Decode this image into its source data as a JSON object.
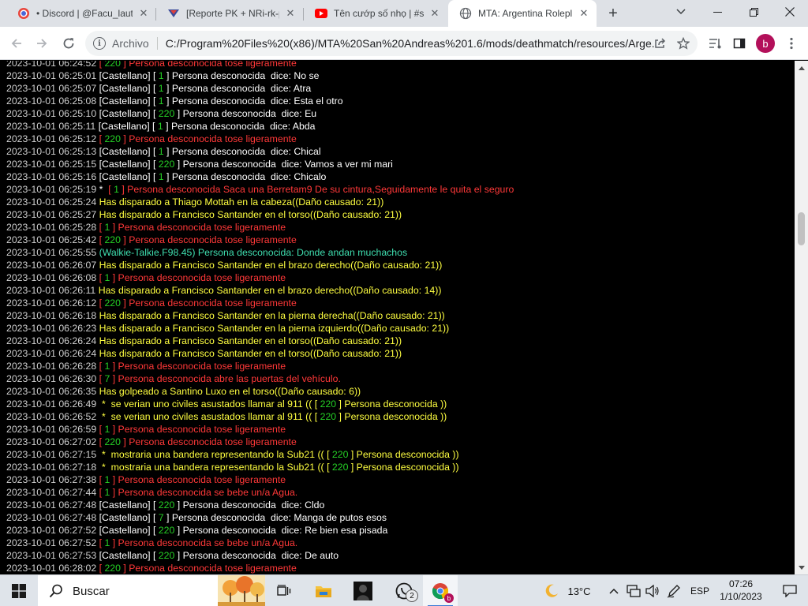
{
  "browser": {
    "tabs": [
      {
        "title": "• Discord | @Facu_laut",
        "active": false,
        "favicon": "discord-favicon"
      },
      {
        "title": "[Reporte PK + NRi-rk-p",
        "active": false,
        "favicon": "forum-favicon"
      },
      {
        "title": "Tên cướp số nhọ | #sho",
        "active": false,
        "favicon": "youtube-favicon"
      },
      {
        "title": "MTA: Argentina Rolepl",
        "active": true,
        "favicon": "globe-favicon"
      }
    ],
    "address_prefix": "Archivo",
    "url": "C:/Program%20Files%20(x86)/MTA%20San%20Andreas%201.6/mods/deathmatch/resources/Arge...",
    "profile_initial": "b"
  },
  "log": [
    {
      "ts": "2023-10-01 06:24:52",
      "parts": [
        {
          "c": "red",
          "t": " [ "
        },
        {
          "c": "green",
          "t": "220"
        },
        {
          "c": "red",
          "t": " ] Persona desconocida tose ligeramente"
        }
      ]
    },
    {
      "ts": "2023-10-01 06:25:01",
      "parts": [
        {
          "c": "white",
          "t": " [Castellano] [ "
        },
        {
          "c": "green",
          "t": "1"
        },
        {
          "c": "white",
          "t": " ] Persona desconocida  dice: No se"
        }
      ]
    },
    {
      "ts": "2023-10-01 06:25:07",
      "parts": [
        {
          "c": "white",
          "t": " [Castellano] [ "
        },
        {
          "c": "green",
          "t": "1"
        },
        {
          "c": "white",
          "t": " ] Persona desconocida  dice: Atra"
        }
      ]
    },
    {
      "ts": "2023-10-01 06:25:08",
      "parts": [
        {
          "c": "white",
          "t": " [Castellano] [ "
        },
        {
          "c": "green",
          "t": "1"
        },
        {
          "c": "white",
          "t": " ] Persona desconocida  dice: Esta el otro"
        }
      ]
    },
    {
      "ts": "2023-10-01 06:25:10",
      "parts": [
        {
          "c": "white",
          "t": " [Castellano] [ "
        },
        {
          "c": "green",
          "t": "220"
        },
        {
          "c": "white",
          "t": " ] Persona desconocida  dice: Eu"
        }
      ]
    },
    {
      "ts": "2023-10-01 06:25:11",
      "parts": [
        {
          "c": "white",
          "t": " [Castellano] [ "
        },
        {
          "c": "green",
          "t": "1"
        },
        {
          "c": "white",
          "t": " ] Persona desconocida  dice: Abda"
        }
      ]
    },
    {
      "ts": "2023-10-01 06:25:12",
      "parts": [
        {
          "c": "red",
          "t": " [ "
        },
        {
          "c": "green",
          "t": "220"
        },
        {
          "c": "red",
          "t": " ] Persona desconocida tose ligeramente"
        }
      ]
    },
    {
      "ts": "2023-10-01 06:25:13",
      "parts": [
        {
          "c": "white",
          "t": " [Castellano] [ "
        },
        {
          "c": "green",
          "t": "1"
        },
        {
          "c": "white",
          "t": " ] Persona desconocida  dice: Chical"
        }
      ]
    },
    {
      "ts": "2023-10-01 06:25:15",
      "parts": [
        {
          "c": "white",
          "t": " [Castellano] [ "
        },
        {
          "c": "green",
          "t": "220"
        },
        {
          "c": "white",
          "t": " ] Persona desconocida  dice: Vamos a ver mi mari"
        }
      ]
    },
    {
      "ts": "2023-10-01 06:25:16",
      "parts": [
        {
          "c": "white",
          "t": " [Castellano] [ "
        },
        {
          "c": "green",
          "t": "1"
        },
        {
          "c": "white",
          "t": " ] Persona desconocida  dice: Chicalo"
        }
      ]
    },
    {
      "ts": "2023-10-01 06:25:19",
      "parts": [
        {
          "c": "white",
          "t": " *  "
        },
        {
          "c": "red",
          "t": "[ "
        },
        {
          "c": "green",
          "t": "1"
        },
        {
          "c": "red",
          "t": " ] Persona desconocida Saca una Berretam9 De su cintura,Seguidamente le quita el seguro"
        }
      ]
    },
    {
      "ts": "2023-10-01 06:25:24",
      "parts": [
        {
          "c": "yellow",
          "t": " Has disparado a Thiago Mottah en la cabeza((Daño causado: 21))"
        }
      ]
    },
    {
      "ts": "2023-10-01 06:25:27",
      "parts": [
        {
          "c": "yellow",
          "t": " Has disparado a Francisco Santander en el torso((Daño causado: 21))"
        }
      ]
    },
    {
      "ts": "2023-10-01 06:25:28",
      "parts": [
        {
          "c": "red",
          "t": " [ "
        },
        {
          "c": "green",
          "t": "1"
        },
        {
          "c": "red",
          "t": " ] Persona desconocida tose ligeramente"
        }
      ]
    },
    {
      "ts": "2023-10-01 06:25:42",
      "parts": [
        {
          "c": "red",
          "t": " [ "
        },
        {
          "c": "green",
          "t": "220"
        },
        {
          "c": "red",
          "t": " ] Persona desconocida tose ligeramente"
        }
      ]
    },
    {
      "ts": "2023-10-01 06:25:55",
      "parts": [
        {
          "c": "cyan",
          "t": " (Walkie-Talkie.F98.45) Persona desconocida: Donde andan muchachos"
        }
      ]
    },
    {
      "ts": "2023-10-01 06:26:07",
      "parts": [
        {
          "c": "yellow",
          "t": " Has disparado a Francisco Santander en el brazo derecho((Daño causado: 21))"
        }
      ]
    },
    {
      "ts": "2023-10-01 06:26:08",
      "parts": [
        {
          "c": "red",
          "t": " [ "
        },
        {
          "c": "green",
          "t": "1"
        },
        {
          "c": "red",
          "t": " ] Persona desconocida tose ligeramente"
        }
      ]
    },
    {
      "ts": "2023-10-01 06:26:11",
      "parts": [
        {
          "c": "yellow",
          "t": " Has disparado a Francisco Santander en el brazo derecho((Daño causado: 14))"
        }
      ]
    },
    {
      "ts": "2023-10-01 06:26:12",
      "parts": [
        {
          "c": "red",
          "t": " [ "
        },
        {
          "c": "green",
          "t": "220"
        },
        {
          "c": "red",
          "t": " ] Persona desconocida tose ligeramente"
        }
      ]
    },
    {
      "ts": "2023-10-01 06:26:18",
      "parts": [
        {
          "c": "yellow",
          "t": " Has disparado a Francisco Santander en la pierna derecha((Daño causado: 21))"
        }
      ]
    },
    {
      "ts": "2023-10-01 06:26:23",
      "parts": [
        {
          "c": "yellow",
          "t": " Has disparado a Francisco Santander en la pierna izquierdo((Daño causado: 21))"
        }
      ]
    },
    {
      "ts": "2023-10-01 06:26:24",
      "parts": [
        {
          "c": "yellow",
          "t": " Has disparado a Francisco Santander en el torso((Daño causado: 21))"
        }
      ]
    },
    {
      "ts": "2023-10-01 06:26:24",
      "parts": [
        {
          "c": "yellow",
          "t": " Has disparado a Francisco Santander en el torso((Daño causado: 21))"
        }
      ]
    },
    {
      "ts": "2023-10-01 06:26:28",
      "parts": [
        {
          "c": "red",
          "t": " [ "
        },
        {
          "c": "green",
          "t": "1"
        },
        {
          "c": "red",
          "t": " ] Persona desconocida tose ligeramente"
        }
      ]
    },
    {
      "ts": "2023-10-01 06:26:30",
      "parts": [
        {
          "c": "red",
          "t": " [ "
        },
        {
          "c": "green",
          "t": "7"
        },
        {
          "c": "red",
          "t": " ] Persona desconocida abre las puertas del vehículo."
        }
      ]
    },
    {
      "ts": "2023-10-01 06:26:35",
      "parts": [
        {
          "c": "yellow",
          "t": " Has golpeado a Santino Luxo en el torso((Daño causado: 6))"
        }
      ]
    },
    {
      "ts": "2023-10-01 06:26:49",
      "parts": [
        {
          "c": "yellow",
          "t": "  *  se verian uno civiles asustados llamar al 911 (( [ "
        },
        {
          "c": "green",
          "t": "220"
        },
        {
          "c": "yellow",
          "t": " ] Persona desconocida ))"
        }
      ]
    },
    {
      "ts": "2023-10-01 06:26:52",
      "parts": [
        {
          "c": "yellow",
          "t": "  *  se verian uno civiles asustados llamar al 911 (( [ "
        },
        {
          "c": "green",
          "t": "220"
        },
        {
          "c": "yellow",
          "t": " ] Persona desconocida ))"
        }
      ]
    },
    {
      "ts": "2023-10-01 06:26:59",
      "parts": [
        {
          "c": "red",
          "t": " [ "
        },
        {
          "c": "green",
          "t": "1"
        },
        {
          "c": "red",
          "t": " ] Persona desconocida tose ligeramente"
        }
      ]
    },
    {
      "ts": "2023-10-01 06:27:02",
      "parts": [
        {
          "c": "red",
          "t": " [ "
        },
        {
          "c": "green",
          "t": "220"
        },
        {
          "c": "red",
          "t": " ] Persona desconocida tose ligeramente"
        }
      ]
    },
    {
      "ts": "2023-10-01 06:27:15",
      "parts": [
        {
          "c": "yellow",
          "t": "  *  mostraria una bandera representando la Sub21 (( [ "
        },
        {
          "c": "green",
          "t": "220"
        },
        {
          "c": "yellow",
          "t": " ] Persona desconocida ))"
        }
      ]
    },
    {
      "ts": "2023-10-01 06:27:18",
      "parts": [
        {
          "c": "yellow",
          "t": "  *  mostraria una bandera representando la Sub21 (( [ "
        },
        {
          "c": "green",
          "t": "220"
        },
        {
          "c": "yellow",
          "t": " ] Persona desconocida ))"
        }
      ]
    },
    {
      "ts": "2023-10-01 06:27:38",
      "parts": [
        {
          "c": "red",
          "t": " [ "
        },
        {
          "c": "green",
          "t": "1"
        },
        {
          "c": "red",
          "t": " ] Persona desconocida tose ligeramente"
        }
      ]
    },
    {
      "ts": "2023-10-01 06:27:44",
      "parts": [
        {
          "c": "red",
          "t": " [ "
        },
        {
          "c": "green",
          "t": "1"
        },
        {
          "c": "red",
          "t": " ] Persona desconocida se bebe un/a Agua."
        }
      ]
    },
    {
      "ts": "2023-10-01 06:27:48",
      "parts": [
        {
          "c": "white",
          "t": " [Castellano] [ "
        },
        {
          "c": "green",
          "t": "220"
        },
        {
          "c": "white",
          "t": " ] Persona desconocida  dice: Cldo"
        }
      ]
    },
    {
      "ts": "2023-10-01 06:27:48",
      "parts": [
        {
          "c": "white",
          "t": " [Castellano] [ "
        },
        {
          "c": "green",
          "t": "7"
        },
        {
          "c": "white",
          "t": " ] Persona desconocida  dice: Manga de putos esos"
        }
      ]
    },
    {
      "ts": "2023-10-01 06:27:52",
      "parts": [
        {
          "c": "white",
          "t": " [Castellano] [ "
        },
        {
          "c": "green",
          "t": "220"
        },
        {
          "c": "white",
          "t": " ] Persona desconocida  dice: Re bien esa pisada"
        }
      ]
    },
    {
      "ts": "2023-10-01 06:27:52",
      "parts": [
        {
          "c": "red",
          "t": " [ "
        },
        {
          "c": "green",
          "t": "1"
        },
        {
          "c": "red",
          "t": " ] Persona desconocida se bebe un/a Agua."
        }
      ]
    },
    {
      "ts": "2023-10-01 06:27:53",
      "parts": [
        {
          "c": "white",
          "t": " [Castellano] [ "
        },
        {
          "c": "green",
          "t": "220"
        },
        {
          "c": "white",
          "t": " ] Persona desconocida  dice: De auto"
        }
      ]
    },
    {
      "ts": "2023-10-01 06:28:02",
      "parts": [
        {
          "c": "red",
          "t": " [ "
        },
        {
          "c": "green",
          "t": "220"
        },
        {
          "c": "red",
          "t": " ] Persona desconocida tose ligeramente"
        }
      ]
    }
  ],
  "taskbar": {
    "search_label": "Buscar",
    "whatsapp_badge": "2",
    "weather_temp": "13°C",
    "language": "ESP",
    "time": "07:26",
    "date": "1/10/2023"
  }
}
